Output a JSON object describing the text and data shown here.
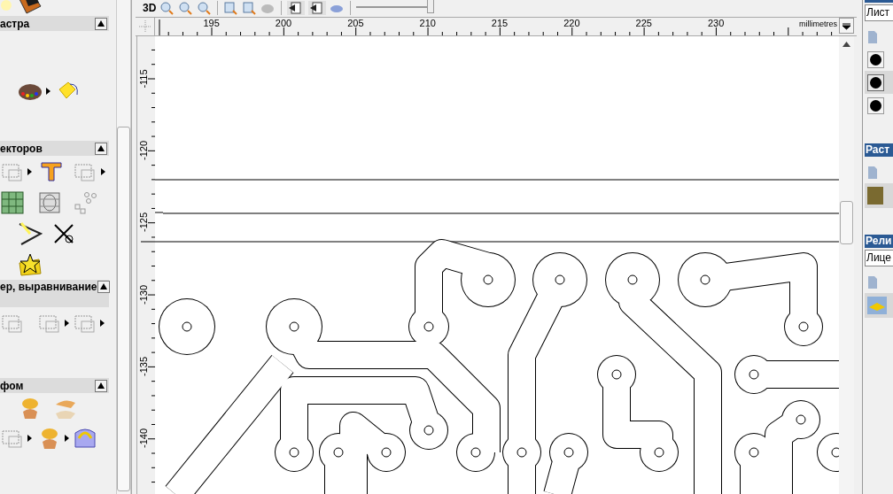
{
  "toolbar": {
    "label_3d": "3D",
    "zoom_slider": {
      "level": 1
    }
  },
  "left_panel": {
    "sections": [
      {
        "title": "астра"
      },
      {
        "title": "екторов"
      },
      {
        "title": "ер, выравнивание"
      },
      {
        "title": "фом"
      }
    ]
  },
  "rulers": {
    "horizontal": {
      "ticks": [
        "195",
        "200",
        "205",
        "210",
        "215",
        "220",
        "225",
        "230"
      ],
      "unit": "millimetres"
    },
    "vertical": {
      "ticks": [
        "-115",
        "-120",
        "-125",
        "-130",
        "-135",
        "-140"
      ]
    }
  },
  "right_panel": {
    "pages_field": {
      "value": "Лист"
    },
    "layers": [
      {
        "selected": false
      },
      {
        "selected": true
      },
      {
        "selected": false
      }
    ],
    "raster": {
      "title": "Раст",
      "items": [
        {
          "selected": true
        }
      ]
    },
    "relief": {
      "title": "Рели",
      "field": {
        "value": "Лице"
      },
      "items": [
        {
          "selected": true
        }
      ]
    }
  }
}
